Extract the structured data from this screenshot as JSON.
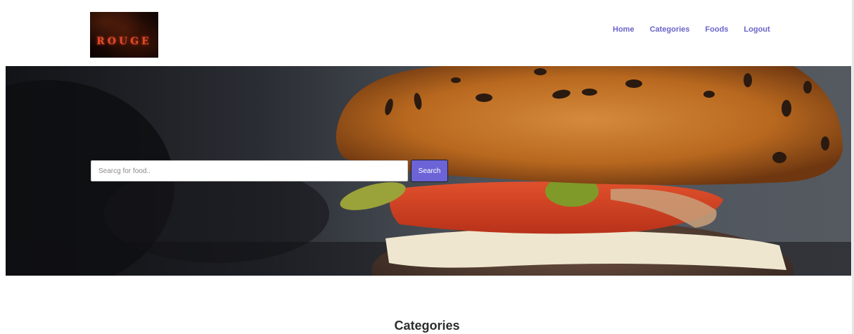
{
  "header": {
    "logo_text": "ROUGE",
    "nav": [
      {
        "label": "Home"
      },
      {
        "label": "Categories"
      },
      {
        "label": "Foods"
      },
      {
        "label": "Logout"
      }
    ]
  },
  "hero": {
    "image": "burger-photo",
    "search": {
      "placeholder": "Searcg for food..",
      "value": "",
      "button_label": "Search"
    }
  },
  "categories": {
    "title": "Categories"
  },
  "colors": {
    "nav_link": "#6a64c9",
    "search_button": "#6b63d6"
  }
}
